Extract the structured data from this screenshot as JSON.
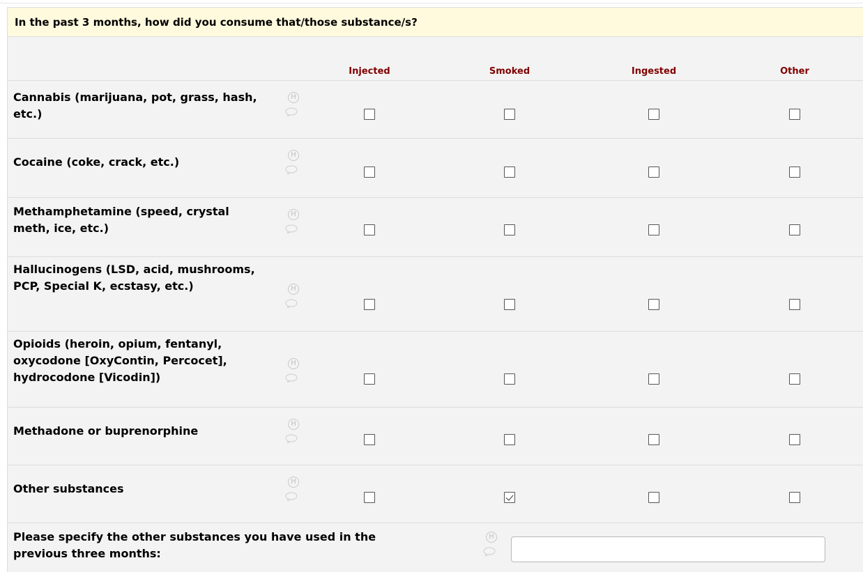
{
  "question": "In the past 3 months, how did you consume that/those substance/s?",
  "columns": [
    "Injected",
    "Smoked",
    "Ingested",
    "Other"
  ],
  "icons": {
    "history": "H"
  },
  "rows": [
    {
      "label": "Cannabis (marijuana, pot, grass, hash, etc.)",
      "checked": [
        false,
        false,
        false,
        false
      ]
    },
    {
      "label": "Cocaine (coke, crack, etc.)",
      "checked": [
        false,
        false,
        false,
        false
      ]
    },
    {
      "label": "Methamphetamine (speed, crystal meth, ice, etc.)",
      "checked": [
        false,
        false,
        false,
        false
      ]
    },
    {
      "label": "Hallucinogens (LSD, acid, mushrooms, PCP, Special K, ecstasy, etc.)",
      "checked": [
        false,
        false,
        false,
        false
      ]
    },
    {
      "label": "Opioids (heroin, opium, fentanyl, oxycodone [OxyContin, Percocet], hydrocodone [Vicodin])",
      "checked": [
        false,
        false,
        false,
        false
      ]
    },
    {
      "label": "Methadone or buprenorphine",
      "checked": [
        false,
        false,
        false,
        false
      ]
    },
    {
      "label": "Other substances",
      "checked": [
        false,
        true,
        false,
        false
      ]
    }
  ],
  "specify": {
    "label": "Please specify the other substances you have used in the previous three months:",
    "value": ""
  }
}
